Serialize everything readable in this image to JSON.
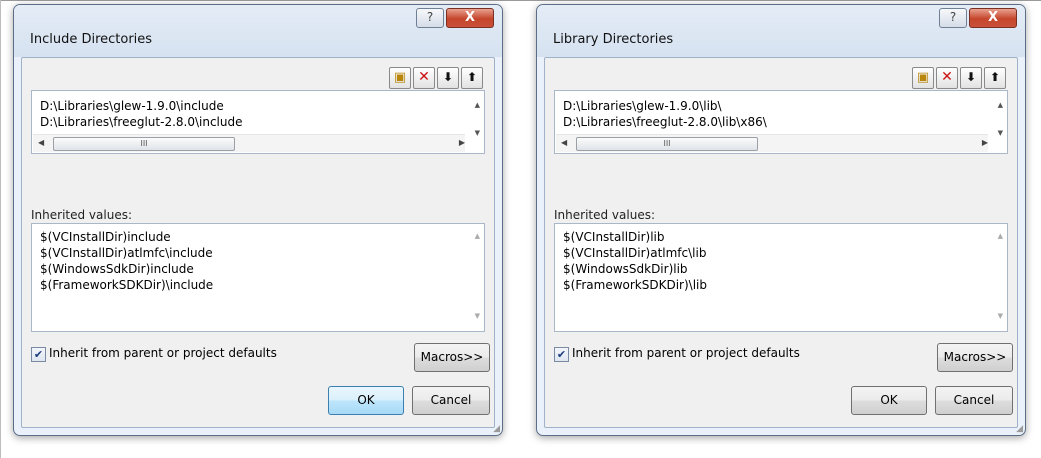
{
  "dialogs": [
    {
      "title": "Include Directories",
      "help_glyph": "?",
      "close_glyph": "X",
      "toolbar": {
        "new_folder_glyph": "▣",
        "delete_glyph": "✕",
        "move_down_glyph": "⬇",
        "move_up_glyph": "⬆"
      },
      "directories": [
        "D:\\Libraries\\glew-1.9.0\\include",
        "D:\\Libraries\\freeglut-2.8.0\\include"
      ],
      "inherited_label": "Inherited values:",
      "inherited_values": [
        "$(VCInstallDir)include",
        "$(VCInstallDir)atlmfc\\include",
        "$(WindowsSdkDir)include",
        "$(FrameworkSDKDir)\\include"
      ],
      "inherit_checkbox": {
        "label": "Inherit from parent or project defaults",
        "checked": true
      },
      "buttons": {
        "macros": "Macros>>",
        "ok": "OK",
        "cancel": "Cancel"
      },
      "ok_is_default": true
    },
    {
      "title": "Library Directories",
      "help_glyph": "?",
      "close_glyph": "X",
      "toolbar": {
        "new_folder_glyph": "▣",
        "delete_glyph": "✕",
        "move_down_glyph": "⬇",
        "move_up_glyph": "⬆"
      },
      "directories": [
        "D:\\Libraries\\glew-1.9.0\\lib\\",
        "D:\\Libraries\\freeglut-2.8.0\\lib\\x86\\"
      ],
      "inherited_label": "Inherited values:",
      "inherited_values": [
        "$(VCInstallDir)lib",
        "$(VCInstallDir)atlmfc\\lib",
        "$(WindowsSdkDir)lib",
        "$(FrameworkSDKDir)\\lib"
      ],
      "inherit_checkbox": {
        "label": "Inherit from parent or project defaults",
        "checked": true
      },
      "buttons": {
        "macros": "Macros>>",
        "ok": "OK",
        "cancel": "Cancel"
      },
      "ok_is_default": false
    }
  ],
  "scrollbar": {
    "thumb_grip": "III",
    "left_arrow": "◀",
    "right_arrow": "▶",
    "up_arrow": "▲",
    "down_arrow": "▼"
  },
  "check_glyph": "✔",
  "resize_grip": "◢"
}
